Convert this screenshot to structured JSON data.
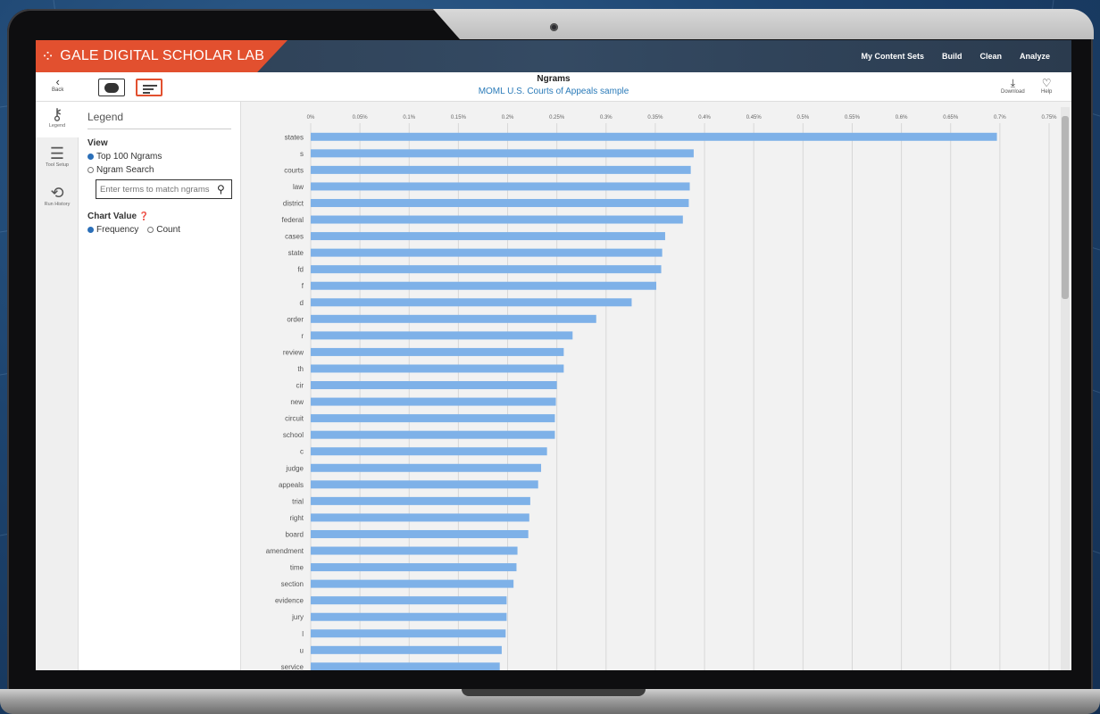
{
  "app": {
    "brand": "GALE DIGITAL SCHOLAR LAB",
    "brand_color": "#e2502f",
    "nav": [
      "My Content Sets",
      "Build",
      "Clean",
      "Analyze"
    ]
  },
  "toolbar": {
    "back_label": "Back",
    "title": "Ngrams",
    "subtitle": "MOML U.S. Courts of Appeals sample",
    "download_label": "Download",
    "help_label": "Help"
  },
  "rail": {
    "items": [
      {
        "label": "Legend",
        "icon": "key-icon"
      },
      {
        "label": "Tool Setup",
        "icon": "sliders-icon"
      },
      {
        "label": "Run History",
        "icon": "history-icon"
      }
    ]
  },
  "legend": {
    "title": "Legend",
    "view_label": "View",
    "view_options": [
      "Top 100 Ngrams",
      "Ngram Search"
    ],
    "view_selected": "Top 100 Ngrams",
    "search_placeholder": "Enter terms to match ngrams",
    "chart_value_label": "Chart Value",
    "chart_value_options": [
      "Frequency",
      "Count"
    ],
    "chart_value_selected": "Frequency"
  },
  "chart_data": {
    "type": "bar",
    "orientation": "horizontal",
    "bar_color": "#7eb1e8",
    "xlim": [
      0,
      0.75
    ],
    "x_ticks": [
      "0%",
      "0.05%",
      "0.1%",
      "0.15%",
      "0.2%",
      "0.25%",
      "0.3%",
      "0.35%",
      "0.4%",
      "0.45%",
      "0.5%",
      "0.55%",
      "0.6%",
      "0.65%",
      "0.7%",
      "0.75%"
    ],
    "grid": true,
    "categories": [
      "states",
      "s",
      "courts",
      "law",
      "district",
      "federal",
      "cases",
      "state",
      "fd",
      "f",
      "d",
      "order",
      "r",
      "review",
      "th",
      "cir",
      "new",
      "circuit",
      "school",
      "c",
      "judge",
      "appeals",
      "trial",
      "right",
      "board",
      "amendment",
      "time",
      "section",
      "evidence",
      "jury",
      "l",
      "u",
      "service"
    ],
    "values": [
      0.697,
      0.389,
      0.386,
      0.385,
      0.384,
      0.378,
      0.36,
      0.357,
      0.356,
      0.351,
      0.326,
      0.29,
      0.266,
      0.257,
      0.257,
      0.25,
      0.249,
      0.248,
      0.248,
      0.24,
      0.234,
      0.231,
      0.223,
      0.222,
      0.221,
      0.21,
      0.209,
      0.206,
      0.199,
      0.199,
      0.198,
      0.194,
      0.192
    ]
  }
}
